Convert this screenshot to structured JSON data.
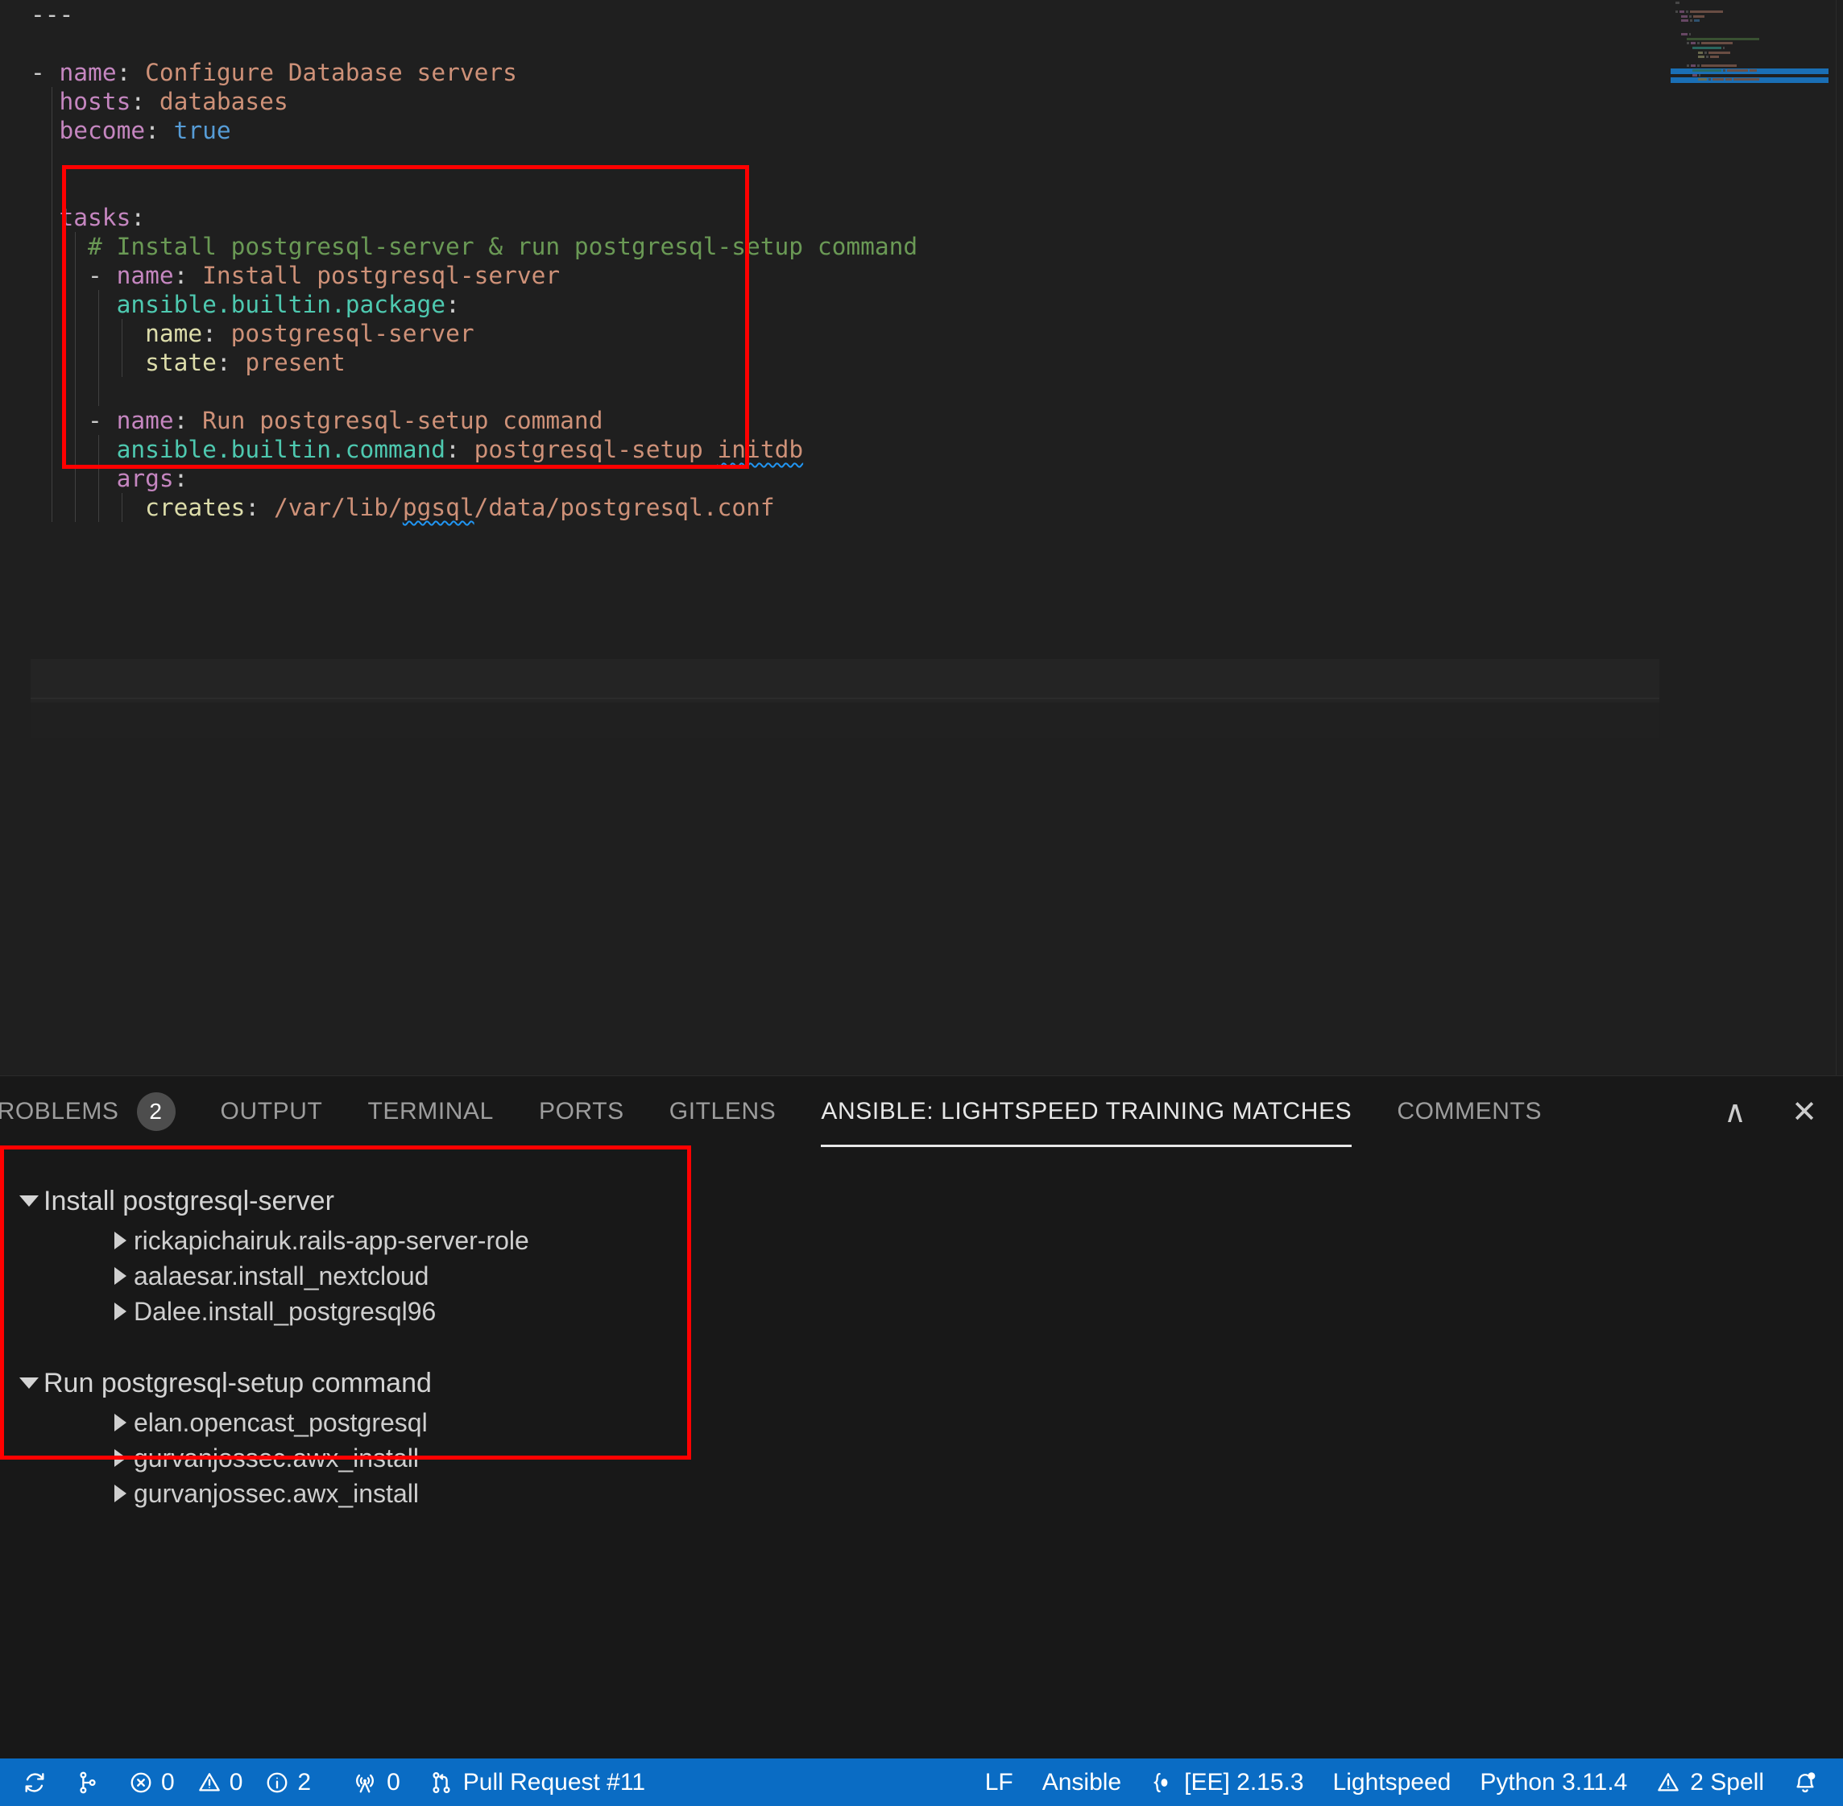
{
  "editor": {
    "language": "yaml",
    "lines": [
      {
        "indent": 0,
        "tokens": [
          {
            "t": "---",
            "c": "t-punct"
          }
        ]
      },
      {
        "indent": 0,
        "tokens": []
      },
      {
        "indent": 0,
        "tokens": [
          {
            "t": "- ",
            "c": "t-dash"
          },
          {
            "t": "name",
            "c": "t-key"
          },
          {
            "t": ": ",
            "c": "t-punct"
          },
          {
            "t": "Configure Database servers",
            "c": "t-str"
          }
        ]
      },
      {
        "indent": 1,
        "tokens": [
          {
            "t": "  hosts",
            "c": "t-key"
          },
          {
            "t": ": ",
            "c": "t-punct"
          },
          {
            "t": "databases",
            "c": "t-str"
          }
        ]
      },
      {
        "indent": 1,
        "tokens": [
          {
            "t": "  become",
            "c": "t-key"
          },
          {
            "t": ": ",
            "c": "t-punct"
          },
          {
            "t": "true",
            "c": "t-bool"
          }
        ]
      },
      {
        "indent": 1,
        "tokens": []
      },
      {
        "indent": 1,
        "tokens": []
      },
      {
        "indent": 1,
        "tokens": [
          {
            "t": "  tasks",
            "c": "t-key"
          },
          {
            "t": ":",
            "c": "t-punct"
          }
        ]
      },
      {
        "indent": 2,
        "tokens": [
          {
            "t": "    # Install postgresql-server & run postgresql-setup command",
            "c": "t-comment"
          }
        ]
      },
      {
        "indent": 2,
        "tokens": [
          {
            "t": "    - ",
            "c": "t-dash"
          },
          {
            "t": "name",
            "c": "t-key"
          },
          {
            "t": ": ",
            "c": "t-punct"
          },
          {
            "t": "Install postgresql-server",
            "c": "t-str"
          }
        ]
      },
      {
        "indent": 3,
        "tokens": [
          {
            "t": "      ansible.builtin.package",
            "c": "t-mod"
          },
          {
            "t": ":",
            "c": "t-punct"
          }
        ]
      },
      {
        "indent": 4,
        "tokens": [
          {
            "t": "        name",
            "c": "t-subkey"
          },
          {
            "t": ": ",
            "c": "t-punct"
          },
          {
            "t": "postgresql-server",
            "c": "t-str"
          }
        ]
      },
      {
        "indent": 4,
        "tokens": [
          {
            "t": "        state",
            "c": "t-subkey"
          },
          {
            "t": ": ",
            "c": "t-punct"
          },
          {
            "t": "present",
            "c": "t-str"
          }
        ]
      },
      {
        "indent": 3,
        "tokens": []
      },
      {
        "indent": 2,
        "tokens": [
          {
            "t": "    - ",
            "c": "t-dash"
          },
          {
            "t": "name",
            "c": "t-key"
          },
          {
            "t": ": ",
            "c": "t-punct"
          },
          {
            "t": "Run postgresql-setup command",
            "c": "t-str"
          }
        ]
      },
      {
        "indent": 3,
        "tokens": [
          {
            "t": "      ansible.builtin.command",
            "c": "t-mod"
          },
          {
            "t": ": ",
            "c": "t-punct"
          },
          {
            "t": "postgresql-setup ",
            "c": "t-str"
          },
          {
            "t": "initdb",
            "c": "t-str",
            "squiggle": true
          }
        ]
      },
      {
        "indent": 3,
        "tokens": [
          {
            "t": "      args",
            "c": "t-key"
          },
          {
            "t": ":",
            "c": "t-punct"
          }
        ]
      },
      {
        "indent": 4,
        "tokens": [
          {
            "t": "        creates",
            "c": "t-subkey"
          },
          {
            "t": ": ",
            "c": "t-punct"
          },
          {
            "t": "/var/lib/",
            "c": "t-str"
          },
          {
            "t": "pgsql",
            "c": "t-str",
            "squiggle": true
          },
          {
            "t": "/data/postgresql.conf",
            "c": "t-str"
          }
        ]
      }
    ],
    "colors": {
      "background": "#1f1f1f",
      "key": "#c586c0",
      "string": "#ce9178",
      "comment": "#6a9955",
      "module": "#4ec9b0",
      "subkey": "#dcdcaa",
      "boolean": "#569cd6",
      "squiggle": "#2196f3",
      "annotation_box": "#ff0000"
    }
  },
  "panel": {
    "tabs": [
      {
        "label": "PROBLEMS",
        "badge": "2",
        "active": false,
        "truncated": true
      },
      {
        "label": "OUTPUT",
        "badge": null,
        "active": false
      },
      {
        "label": "TERMINAL",
        "badge": null,
        "active": false
      },
      {
        "label": "PORTS",
        "badge": null,
        "active": false
      },
      {
        "label": "GITLENS",
        "badge": null,
        "active": false
      },
      {
        "label": "ANSIBLE: LIGHTSPEED TRAINING MATCHES",
        "badge": null,
        "active": true
      },
      {
        "label": "COMMENTS",
        "badge": null,
        "active": false
      }
    ],
    "actions": [
      {
        "name": "maximize-panel",
        "glyph": "∧"
      },
      {
        "name": "close-panel",
        "glyph": "✕"
      }
    ],
    "tree": [
      {
        "label": "Install postgresql-server",
        "expanded": true,
        "children": [
          "rickapichairuk.rails-app-server-role",
          "aalaesar.install_nextcloud",
          "Dalee.install_postgresql96"
        ]
      },
      {
        "label": "Run postgresql-setup command",
        "expanded": true,
        "children": [
          "elan.opencast_postgresql",
          "gurvanjossec.awx_install",
          "gurvanjossec.awx_install"
        ]
      }
    ]
  },
  "statusbar": {
    "background": "#0a6cc4",
    "left": [
      {
        "name": "remote-sync-icon",
        "icon": "sync-icon",
        "label": ""
      },
      {
        "name": "source-control-branch",
        "icon": "branch-icon",
        "label": ""
      },
      {
        "name": "problems-summary",
        "errors": "0",
        "warnings": "0",
        "infos": "2"
      },
      {
        "name": "ports-forwarded",
        "icon": "radio-tower-icon",
        "label": "0"
      },
      {
        "name": "pull-request",
        "icon": "git-pull-request-icon",
        "label": "Pull Request #11"
      }
    ],
    "right": [
      {
        "name": "eol-indicator",
        "label": "LF"
      },
      {
        "name": "language-mode",
        "label": "Ansible"
      },
      {
        "name": "execution-environment",
        "icon": "ee-icon",
        "label": "[EE] 2.15.3"
      },
      {
        "name": "lightspeed-status",
        "label": "Lightspeed"
      },
      {
        "name": "python-interpreter",
        "label": "Python 3.11.4"
      },
      {
        "name": "spell-checker",
        "icon": "warning-icon",
        "label": "2 Spell"
      },
      {
        "name": "notifications",
        "icon": "bell-dot-icon",
        "label": ""
      }
    ]
  }
}
